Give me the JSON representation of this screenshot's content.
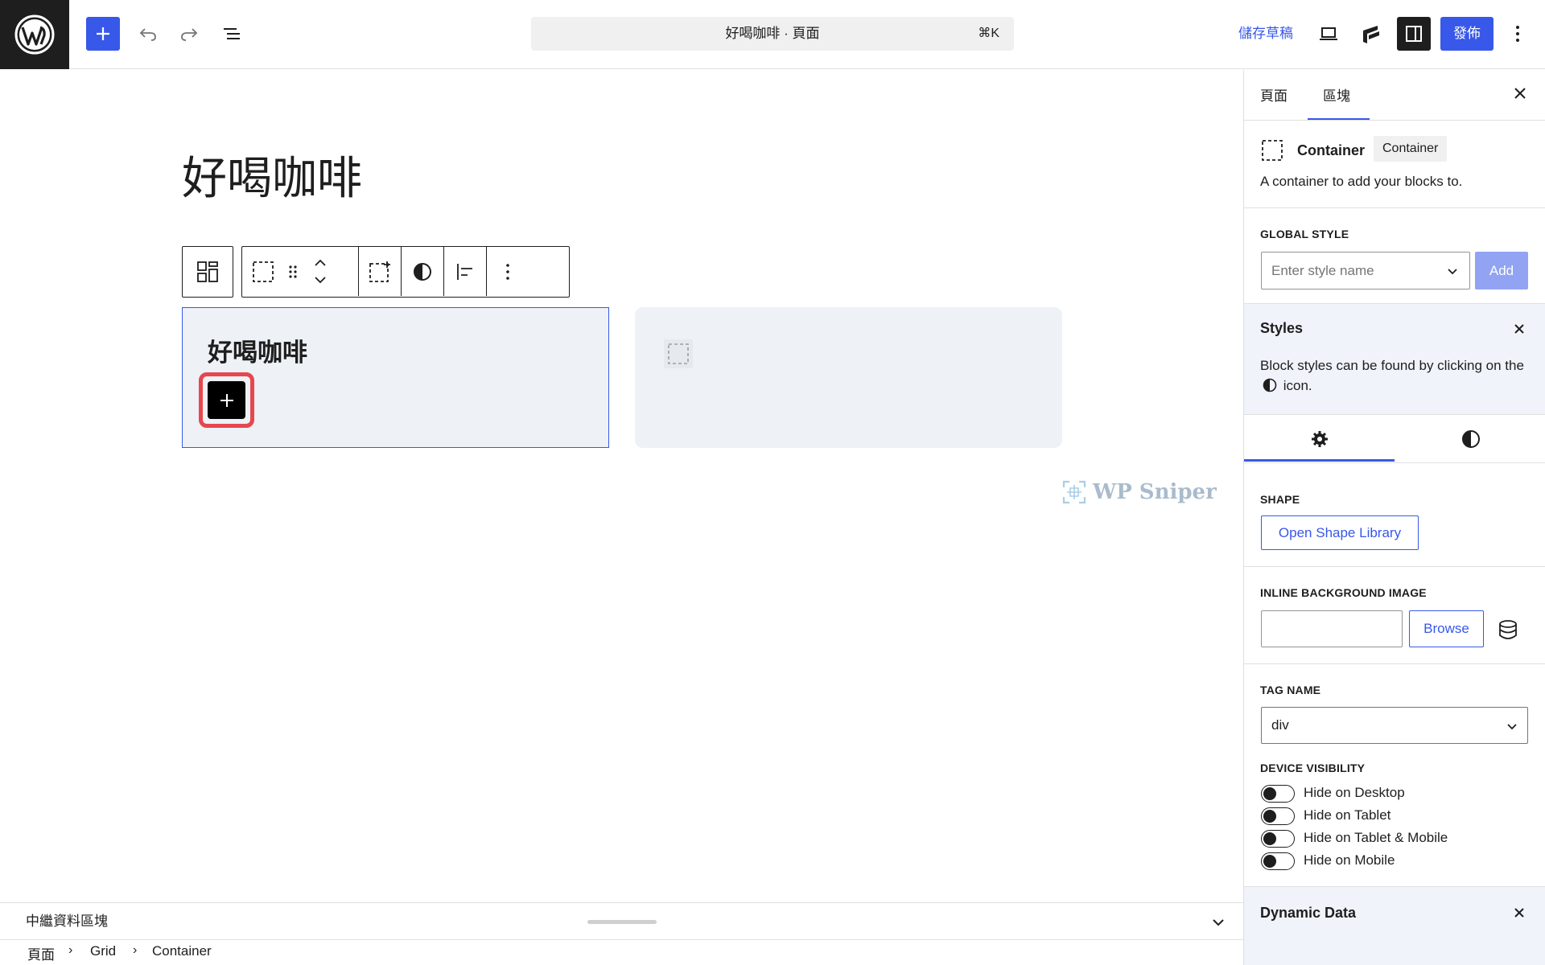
{
  "header": {
    "document_title": "好喝咖啡 · 頁面",
    "command_shortcut": "⌘K",
    "save_draft_label": "儲存草稿",
    "publish_label": "發佈"
  },
  "canvas": {
    "page_title": "好喝咖啡",
    "container_1_heading": "好喝咖啡",
    "watermark": "WP Sniper"
  },
  "bottom": {
    "panel_label": "中繼資料區塊",
    "breadcrumb": [
      "頁面",
      "Grid",
      "Container"
    ]
  },
  "sidebar": {
    "tabs": [
      "頁面",
      "區塊"
    ],
    "active_tab": "區塊",
    "block_name": "Container",
    "block_badge": "Container",
    "block_description": "A container to add your blocks to.",
    "global_style": {
      "label": "GLOBAL STYLE",
      "placeholder": "Enter style name",
      "add_label": "Add"
    },
    "styles_notice": {
      "title": "Styles",
      "text_before": "Block styles can be found by clicking on the",
      "text_after": "icon."
    },
    "shape": {
      "label": "SHAPE",
      "button_label": "Open Shape Library"
    },
    "inline_bg": {
      "label": "INLINE BACKGROUND IMAGE",
      "browse_label": "Browse"
    },
    "tag_name": {
      "label": "TAG NAME",
      "value": "div"
    },
    "device_visibility": {
      "label": "DEVICE VISIBILITY",
      "options": [
        "Hide on Desktop",
        "Hide on Tablet",
        "Hide on Tablet & Mobile",
        "Hide on Mobile"
      ]
    },
    "dynamic_data_title": "Dynamic Data"
  },
  "colors": {
    "accent": "#3858e9",
    "highlight_ring": "#e6474f",
    "container_bg": "#eef1f6",
    "dark": "#1e1e1e"
  },
  "icons": [
    "wordpress-logo",
    "plus-icon",
    "undo-icon",
    "redo-icon",
    "list-view-icon",
    "desktop-preview-icon",
    "plugin-icon",
    "settings-sidebar-icon",
    "more-vertical-icon",
    "close-icon",
    "container-icon",
    "gear-icon",
    "contrast-icon",
    "database-icon",
    "chevron-down-icon"
  ]
}
